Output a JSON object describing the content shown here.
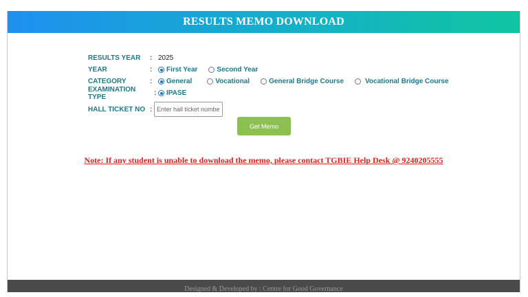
{
  "header": {
    "title": "RESULTS MEMO DOWNLOAD"
  },
  "form": {
    "results_year": {
      "label": "RESULTS YEAR",
      "colon": ":",
      "value": "2025"
    },
    "year": {
      "label": "YEAR",
      "colon": ":",
      "options": [
        {
          "label": "First Year",
          "selected": true
        },
        {
          "label": "Second Year",
          "selected": false
        }
      ]
    },
    "category": {
      "label": "CATEGORY",
      "colon": ":",
      "options": [
        {
          "label": "General",
          "selected": true
        },
        {
          "label": "Vocational",
          "selected": false
        },
        {
          "label": "General Bridge Course",
          "selected": false
        },
        {
          "label": "Vocational Bridge Course",
          "selected": false
        }
      ]
    },
    "exam_type": {
      "label": "EXAMINATION TYPE",
      "colon": ":",
      "options": [
        {
          "label": "IPASE",
          "selected": true
        }
      ]
    },
    "hall_ticket": {
      "label": "HALL TICKET NO",
      "colon": ":",
      "placeholder": "Enter hall ticket number",
      "value": ""
    },
    "submit_label": "Get Memo"
  },
  "note": "Note: If any student is unable to download the memo, please contact TGBIE Help Desk @ 9240205555",
  "footer": {
    "text": "Designed & Developed by : Centre for Good Governance"
  },
  "colors": {
    "header_start": "#1e90f0",
    "header_end": "#10c5a0",
    "label": "#1a7a8c",
    "button": "#8cc152",
    "note": "#e02020",
    "footer": "#4a4a4a"
  }
}
